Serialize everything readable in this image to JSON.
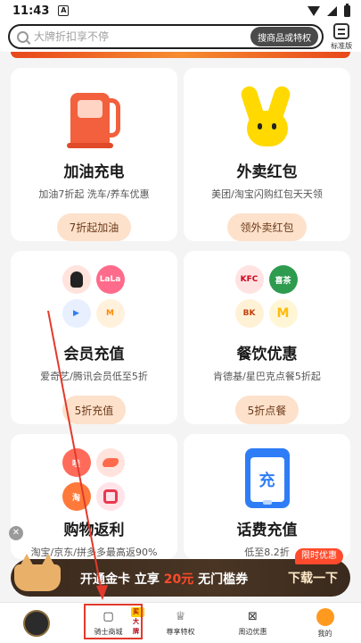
{
  "status_bar": {
    "time": "11:43",
    "notification": "A"
  },
  "search": {
    "placeholder": "大牌折扣享不停",
    "button_label": "搜商品或特权",
    "mode_label": "标准版"
  },
  "cards": [
    {
      "title": "加油充电",
      "subtitle": "加油7折起  洗车/养车优惠",
      "button": "7折起加油",
      "image": "fuel-pump-icon"
    },
    {
      "title": "外卖红包",
      "subtitle": "美团/淘宝闪购红包天天领",
      "button": "领外卖红包",
      "image": "yellow-mascot-icon"
    },
    {
      "title": "会员充值",
      "subtitle": "爱奇艺/腾讯会员低至5折",
      "button": "5折充值",
      "icons": [
        {
          "name": "qq-icon",
          "color": "#ff5a3a",
          "text": ""
        },
        {
          "name": "lala-icon",
          "color": "#ff6b8a",
          "text": "LaLa"
        },
        {
          "name": "tencent-video-icon",
          "color": "#2f7df6",
          "text": "▶"
        },
        {
          "name": "mango-tv-icon",
          "color": "#ff8a00",
          "text": "M"
        }
      ]
    },
    {
      "title": "餐饮优惠",
      "subtitle": "肯德基/星巴克点餐5折起",
      "button": "5折点餐",
      "icons": [
        {
          "name": "kfc-icon",
          "color": "#d0021b",
          "text": "KFC"
        },
        {
          "name": "heytea-icon",
          "color": "#2e9b4f",
          "text": "喜茶"
        },
        {
          "name": "burger-king-icon",
          "color": "#f4a12b",
          "text": "BK"
        },
        {
          "name": "mcdonalds-icon",
          "color": "#ffc107",
          "text": "M"
        }
      ]
    },
    {
      "title": "购物返利",
      "subtitle": "淘宝/京东/拼多多最高返90%",
      "icons": [
        {
          "name": "eleme-icon",
          "color": "#ff5a3a",
          "text": "哇"
        },
        {
          "name": "shopping-bird-icon",
          "color": "#ff6b4a",
          "text": ""
        },
        {
          "name": "taobao-icon",
          "color": "#ff5000",
          "text": "淘"
        },
        {
          "name": "coupon-icon",
          "color": "#e8384f",
          "text": ""
        }
      ]
    },
    {
      "title": "话费充值",
      "subtitle": "低至8.2折",
      "image": "phone-recharge-icon",
      "image_text": "充"
    }
  ],
  "promo": {
    "text_before": "开通金卡 立享",
    "price": "20元",
    "text_after": "无门槛券",
    "cta": "下载一下",
    "tag": "限时优惠"
  },
  "bottom_nav": {
    "items": [
      {
        "label": ""
      },
      {
        "label": "骑士商城",
        "badge": "买大牌"
      },
      {
        "label": "尊享特权"
      },
      {
        "label": "周边优惠"
      },
      {
        "label": "我的"
      }
    ]
  }
}
